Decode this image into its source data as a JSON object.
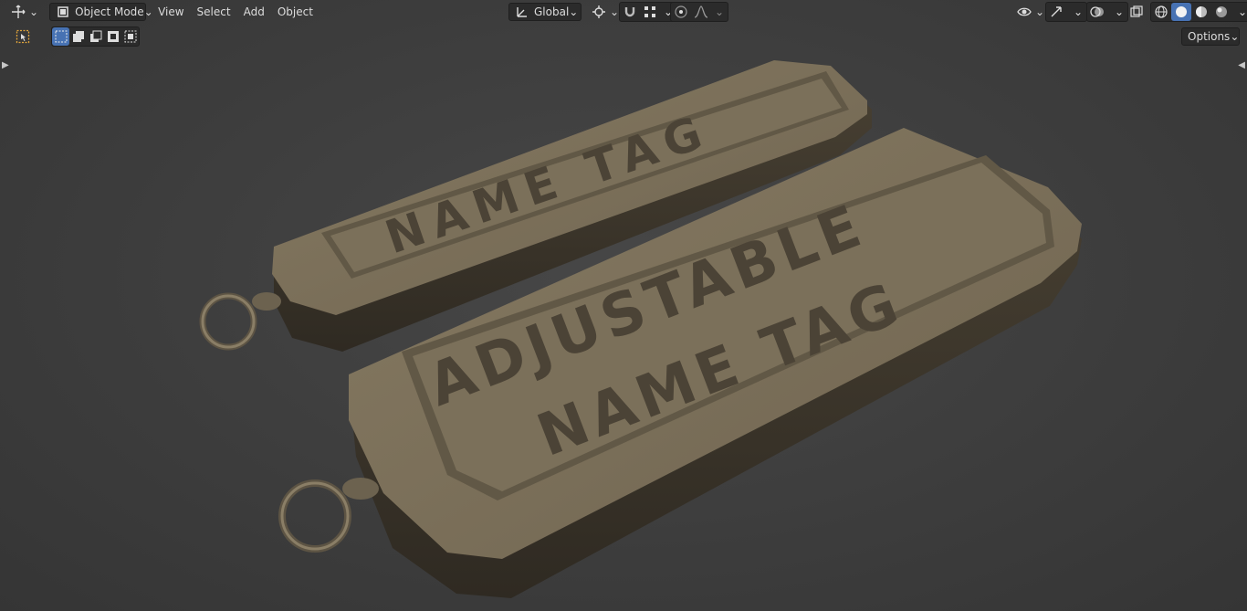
{
  "header": {
    "mode_label": "Object Mode",
    "menus": [
      "View",
      "Select",
      "Add",
      "Object"
    ],
    "orientation_label": "Global",
    "options_label": "Options"
  },
  "icons": {
    "editor_type": "move-3d-icon",
    "mode": "object-mode-icon",
    "orientation": "transform-axes-icon",
    "pivot": "pivot-point-icon",
    "snap": "magnet-icon",
    "proportional": "proportional-edit-icon",
    "visibility": "eye-icon",
    "gizmo": "gizmo-icon",
    "overlay": "overlay-icon",
    "xray": "xray-icon",
    "shading": [
      "wireframe-icon",
      "solid-icon",
      "material-preview-icon",
      "rendered-icon"
    ]
  },
  "colors": {
    "accent": "#4772b3",
    "viewport_bg": "#3d3d3d",
    "model": "#7a6e58"
  }
}
